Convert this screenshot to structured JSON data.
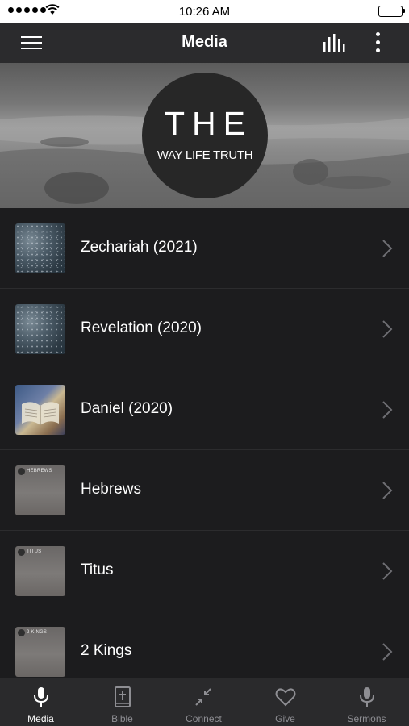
{
  "status_bar": {
    "time": "10:26 AM"
  },
  "header": {
    "title": "Media",
    "menu_icon": "hamburger-menu-icon",
    "equalizer_icon": "equalizer-icon",
    "more_icon": "vertical-dots-icon"
  },
  "banner": {
    "logo_line1": "THE",
    "logo_line2": "WAY LIFE TRUTH"
  },
  "media_list": [
    {
      "label": "Zechariah (2021)",
      "thumb": "storm",
      "thumb_text": ""
    },
    {
      "label": "Revelation (2020)",
      "thumb": "storm",
      "thumb_text": ""
    },
    {
      "label": "Daniel (2020)",
      "thumb": "bible",
      "thumb_text": ""
    },
    {
      "label": "Hebrews",
      "thumb": "gray",
      "thumb_text": "HEBREWS"
    },
    {
      "label": "Titus",
      "thumb": "gray",
      "thumb_text": "TITUS"
    },
    {
      "label": "2 Kings",
      "thumb": "gray",
      "thumb_text": "2 KINGS"
    }
  ],
  "tabs": [
    {
      "label": "Media",
      "icon": "microphone-icon",
      "active": true
    },
    {
      "label": "Bible",
      "icon": "bible-icon",
      "active": false
    },
    {
      "label": "Connect",
      "icon": "connect-arrows-icon",
      "active": false
    },
    {
      "label": "Give",
      "icon": "heart-icon",
      "active": false
    },
    {
      "label": "Sermons",
      "icon": "microphone-icon",
      "active": false
    }
  ],
  "colors": {
    "header_bg": "#2b2b2d",
    "list_bg": "#1c1c1e",
    "tab_bg": "#2a2a2c",
    "inactive_tab": "#8e8e93",
    "active_tab": "#ffffff"
  }
}
